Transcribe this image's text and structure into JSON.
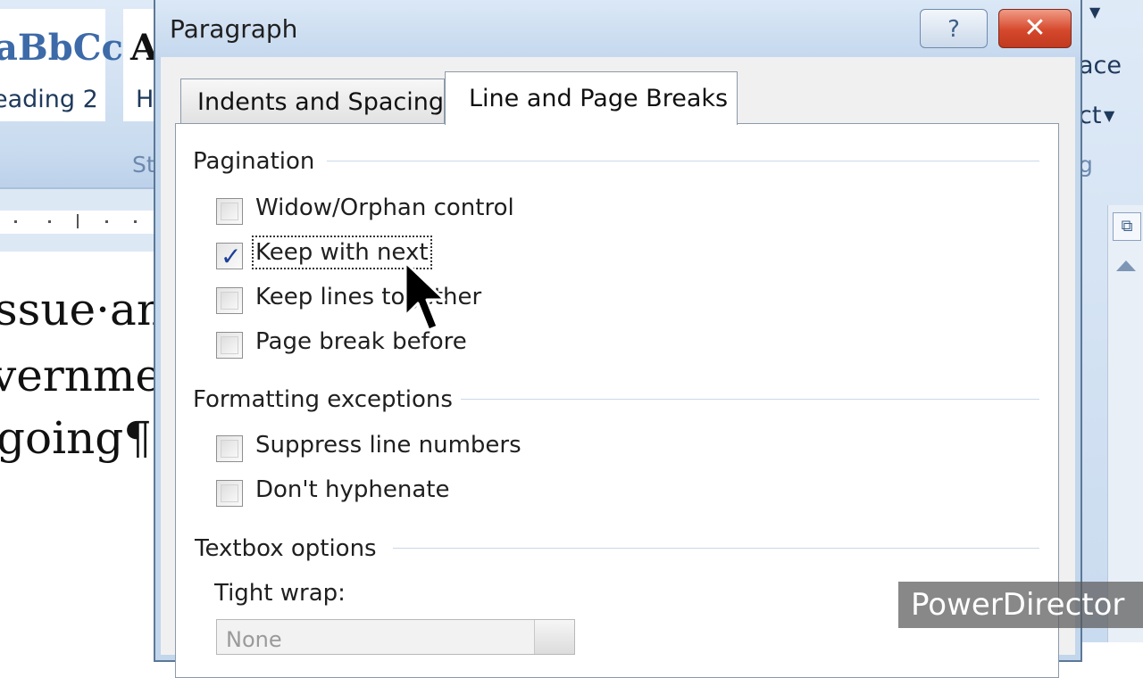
{
  "background": {
    "styles_gallery": [
      {
        "sample": "aBbCc",
        "name": "eading 2"
      },
      {
        "sample": "A",
        "name": "H"
      }
    ],
    "group_label_left": "St",
    "group_label_right": "g",
    "right_ribbon_text_1": "ace",
    "right_ribbon_text_2": "ct",
    "document_lines": [
      "ssue·an",
      "vernme",
      "going¶"
    ]
  },
  "dialog": {
    "title": "Paragraph",
    "help_label": "?",
    "close_label": "✕",
    "tabs": [
      {
        "label": "Indents and Spacing",
        "active": false
      },
      {
        "label": "Line and Page Breaks",
        "active": true
      }
    ],
    "pagination": {
      "heading": "Pagination",
      "options": [
        {
          "label": "Widow/Orphan control",
          "checked": false
        },
        {
          "label": "Keep with next",
          "checked": true
        },
        {
          "label": "Keep lines together",
          "checked": false
        },
        {
          "label": "Page break before",
          "checked": false
        }
      ]
    },
    "formatting_exceptions": {
      "heading": "Formatting exceptions",
      "options": [
        {
          "label": "Suppress line numbers",
          "checked": false
        },
        {
          "label": "Don't hyphenate",
          "checked": false
        }
      ]
    },
    "textbox_options": {
      "heading": "Textbox options",
      "tight_wrap_label": "Tight wrap:",
      "tight_wrap_value": "None"
    }
  },
  "watermark": "PowerDirector",
  "colors": {
    "checkmark": "#1c3f98",
    "close_button": "#d5482c",
    "dialog_frame": "#c2d6ec"
  }
}
